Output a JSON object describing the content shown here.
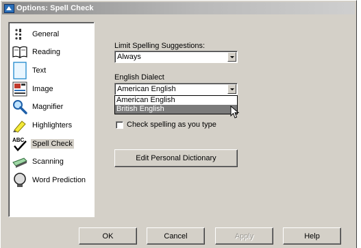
{
  "window": {
    "title": "Options: Spell Check"
  },
  "sidebar": {
    "items": [
      {
        "label": "General",
        "icon": "general-icon"
      },
      {
        "label": "Reading",
        "icon": "reading-icon"
      },
      {
        "label": "Text",
        "icon": "text-icon"
      },
      {
        "label": "Image",
        "icon": "image-icon"
      },
      {
        "label": "Magnifier",
        "icon": "magnifier-icon"
      },
      {
        "label": "Highlighters",
        "icon": "highlighter-icon"
      },
      {
        "label": "Spell Check",
        "icon": "spell-check-icon",
        "selected": true
      },
      {
        "label": "Scanning",
        "icon": "scanner-icon"
      },
      {
        "label": "Word Prediction",
        "icon": "word-prediction-icon"
      }
    ]
  },
  "spellcheck": {
    "limit_label": "Limit Spelling Suggestions:",
    "limit_value": "Always",
    "dialect_label": "English Dialect",
    "dialect_value": "American English",
    "dialect_options": [
      "American English",
      "British English"
    ],
    "dialect_highlighted": "British English",
    "check_as_you_type_label": "Check spelling as you type",
    "check_as_you_type_checked": false,
    "edit_dictionary_label": "Edit Personal Dictionary"
  },
  "buttons": {
    "ok": "OK",
    "cancel": "Cancel",
    "apply": "Apply",
    "help": "Help"
  },
  "colors": {
    "dialog_face": "#d4d0c8",
    "highlight": "#7b7b7b"
  }
}
